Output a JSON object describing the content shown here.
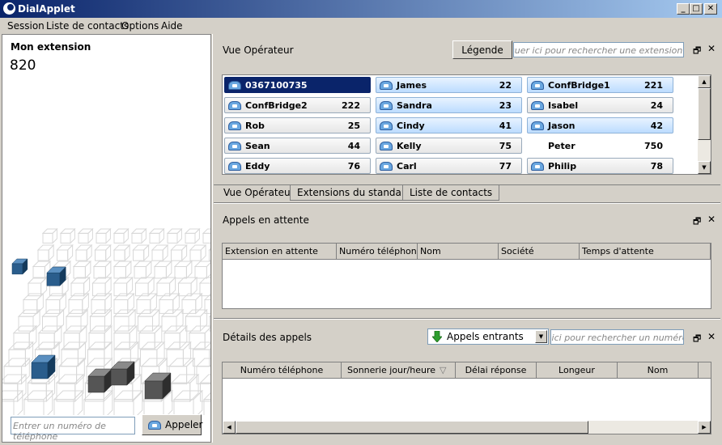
{
  "window": {
    "title": "DialApplet",
    "min": "_",
    "max": "□",
    "close": "✕"
  },
  "menu": [
    {
      "label": "Session"
    },
    {
      "label": "Liste de contacts"
    },
    {
      "label": "Options"
    },
    {
      "label": "Aide"
    }
  ],
  "left": {
    "ext_label": "Mon extension",
    "ext_value": "820",
    "phone_placeholder": "Entrer un numéro de téléphone",
    "call_button": "Appeler"
  },
  "operator": {
    "title": "Vue Opérateur",
    "legend_button": "Légende",
    "search_placeholder": "Cliquer ici pour rechercher une extension",
    "cards": [
      {
        "name": "0367100735",
        "num": "",
        "style": "sel"
      },
      {
        "name": "James",
        "num": "22",
        "style": "blue"
      },
      {
        "name": "ConfBridge1",
        "num": "221",
        "style": "blue"
      },
      {
        "name": "ConfBridge2",
        "num": "222",
        "style": "gray"
      },
      {
        "name": "Sandra",
        "num": "23",
        "style": "blue"
      },
      {
        "name": "Isabel",
        "num": "24",
        "style": "gray"
      },
      {
        "name": "Rob",
        "num": "25",
        "style": "gray"
      },
      {
        "name": "Cindy",
        "num": "41",
        "style": "blue"
      },
      {
        "name": "Jason",
        "num": "42",
        "style": "blue"
      },
      {
        "name": "Sean",
        "num": "44",
        "style": "gray"
      },
      {
        "name": "Kelly",
        "num": "75",
        "style": "gray"
      },
      {
        "name": "Peter",
        "num": "750",
        "style": "plain"
      },
      {
        "name": "Eddy",
        "num": "76",
        "style": "gray"
      },
      {
        "name": "Carl",
        "num": "77",
        "style": "gray"
      },
      {
        "name": "Philip",
        "num": "78",
        "style": "gray"
      }
    ],
    "tabs": [
      {
        "label": "Vue Opérateur",
        "active": true
      },
      {
        "label": "Extensions du standard",
        "active": false
      },
      {
        "label": "Liste de contacts",
        "active": false
      }
    ]
  },
  "waiting": {
    "title": "Appels en attente",
    "columns": [
      "Extension en attente",
      "Numéro téléphone",
      "Nom",
      "Société",
      "Temps d'attente"
    ]
  },
  "details": {
    "title": "Détails des appels",
    "filter_value": "Appels entrants",
    "search_placeholder": "Cliquer ici pour rechercher un numéro",
    "columns": [
      "Numéro téléphone",
      "Sonnerie jour/heure",
      "Délai réponse",
      "Longeur",
      "Nom"
    ],
    "sort_indicator": "▽"
  },
  "icons": {
    "undock": "🗗",
    "close": "✕",
    "scroll_up": "▲",
    "scroll_down": "▼",
    "scroll_left": "◀",
    "scroll_right": "▶",
    "combo_arrow": "▼"
  },
  "colors": {
    "selection": "#0a246a",
    "online_card": "#bcdcff",
    "cube_blue": "#2a5d8c",
    "cube_gray": "#555555"
  }
}
